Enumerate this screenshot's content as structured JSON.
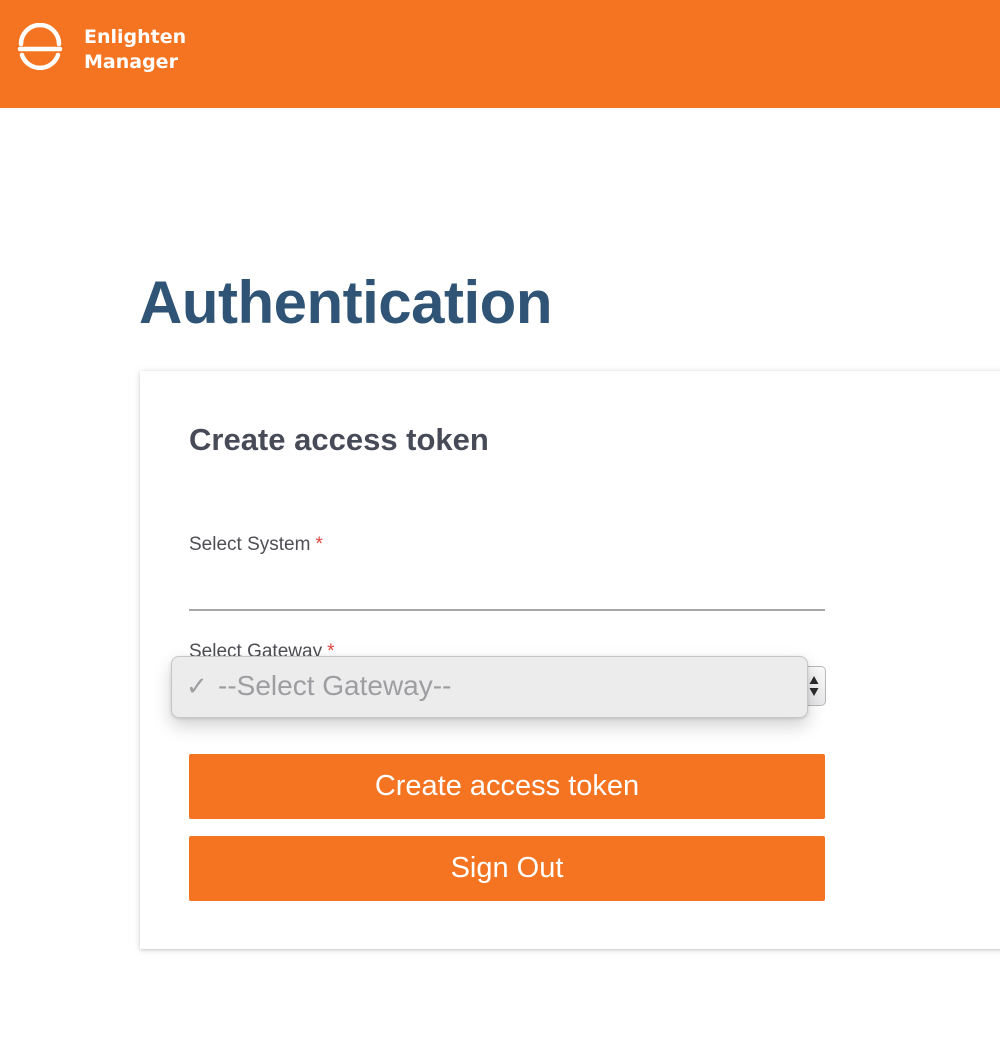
{
  "header": {
    "brand_line1": "Enlighten",
    "brand_line2": "Manager",
    "logo_icon": "enlighten-logo-icon",
    "background_color": "#f47421"
  },
  "main": {
    "title": "Authentication"
  },
  "card": {
    "title": "Create access token",
    "system_field": {
      "label": "Select System",
      "required_marker": "*",
      "value": ""
    },
    "gateway_field": {
      "label": "Select Gateway",
      "required_marker": "*",
      "selected_option": "--Select Gateway--",
      "selected_check": "✓"
    },
    "buttons": {
      "create_label": "Create access token",
      "signout_label": "Sign Out"
    }
  },
  "colors": {
    "accent": "#f47421",
    "title": "#2f5476",
    "card_title": "#474a57",
    "required": "#e0463c"
  }
}
